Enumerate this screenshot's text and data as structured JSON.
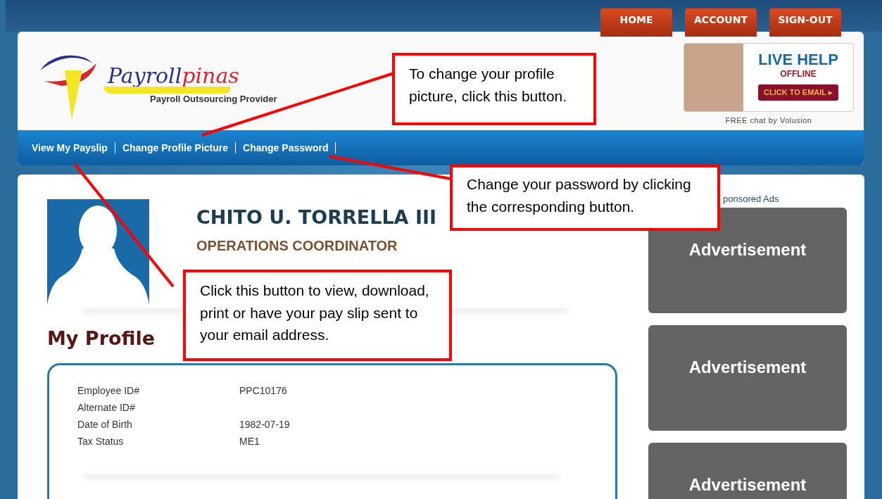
{
  "top_tabs": [
    {
      "label": "HOME"
    },
    {
      "label": "ACCOUNT"
    },
    {
      "label": "SIGN-OUT"
    }
  ],
  "logo": {
    "name_main": "Payroll",
    "name_accent": "pinas",
    "tagline": "Payroll Outsourcing Provider"
  },
  "live_help": {
    "title": "LIVE HELP",
    "status": "OFFLINE",
    "button": "CLICK TO EMAIL ▸",
    "caption": "FREE chat by Volusion"
  },
  "nav": [
    {
      "label": "View My Payslip"
    },
    {
      "label": "Change Profile Picture"
    },
    {
      "label": "Change Password"
    }
  ],
  "profile": {
    "name": "CHITO U. TORRELLA III",
    "position": "OPERATIONS COORDINATOR"
  },
  "section_title": "My Profile",
  "details": [
    {
      "label": "Employee ID#",
      "value": "PPC10176"
    },
    {
      "label": "Alternate ID#"
    },
    {
      "label": "Date of Birth",
      "value": "1982-07-19"
    },
    {
      "label": "Tax Status",
      "value": "ME1"
    }
  ],
  "ads_heading": "ponsored Ads",
  "ads": [
    "Advertisement",
    "Advertisement",
    "Advertisement"
  ],
  "callouts": [
    {
      "text": "To change your profile picture, click this button."
    },
    {
      "text": "Change your password by clicking the corresponding button."
    },
    {
      "text": "Click this button to view, download, print or have your pay slip sent to your email address."
    }
  ]
}
